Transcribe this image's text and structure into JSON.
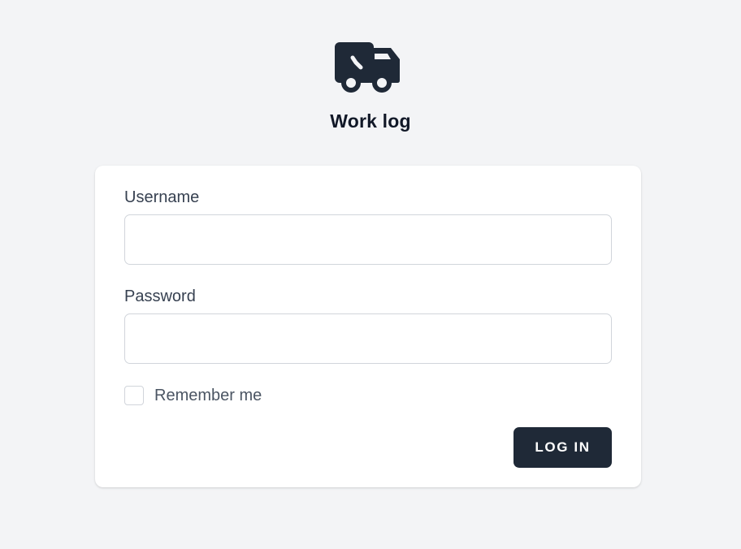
{
  "app": {
    "title": "Work log",
    "logo_icon": "truck-clock-icon"
  },
  "form": {
    "username": {
      "label": "Username",
      "value": "",
      "placeholder": ""
    },
    "password": {
      "label": "Password",
      "value": "",
      "placeholder": ""
    },
    "remember": {
      "label": "Remember me",
      "checked": false
    },
    "submit_label": "LOG IN"
  },
  "colors": {
    "page_background": "#f3f4f6",
    "card_background": "#ffffff",
    "primary": "#1f2937",
    "input_border": "#d1d5db",
    "label_text": "#374151"
  }
}
